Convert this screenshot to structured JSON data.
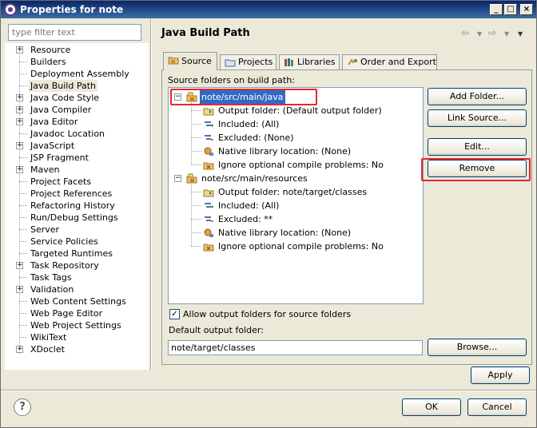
{
  "window": {
    "title": "Properties for note"
  },
  "filter": {
    "placeholder": "type filter text"
  },
  "nav": {
    "items": [
      {
        "label": "Resource",
        "expandable": true
      },
      {
        "label": "Builders",
        "expandable": false
      },
      {
        "label": "Deployment Assembly",
        "expandable": false
      },
      {
        "label": "Java Build Path",
        "expandable": false,
        "selected": true
      },
      {
        "label": "Java Code Style",
        "expandable": true
      },
      {
        "label": "Java Compiler",
        "expandable": true
      },
      {
        "label": "Java Editor",
        "expandable": true
      },
      {
        "label": "Javadoc Location",
        "expandable": false
      },
      {
        "label": "JavaScript",
        "expandable": true
      },
      {
        "label": "JSP Fragment",
        "expandable": false
      },
      {
        "label": "Maven",
        "expandable": true
      },
      {
        "label": "Project Facets",
        "expandable": false
      },
      {
        "label": "Project References",
        "expandable": false
      },
      {
        "label": "Refactoring History",
        "expandable": false
      },
      {
        "label": "Run/Debug Settings",
        "expandable": false
      },
      {
        "label": "Server",
        "expandable": false
      },
      {
        "label": "Service Policies",
        "expandable": false
      },
      {
        "label": "Targeted Runtimes",
        "expandable": false
      },
      {
        "label": "Task Repository",
        "expandable": true
      },
      {
        "label": "Task Tags",
        "expandable": false
      },
      {
        "label": "Validation",
        "expandable": true
      },
      {
        "label": "Web Content Settings",
        "expandable": false
      },
      {
        "label": "Web Page Editor",
        "expandable": false
      },
      {
        "label": "Web Project Settings",
        "expandable": false
      },
      {
        "label": "WikiText",
        "expandable": false
      },
      {
        "label": "XDoclet",
        "expandable": true
      }
    ]
  },
  "page": {
    "title": "Java Build Path",
    "tabs": [
      "Source",
      "Projects",
      "Libraries",
      "Order and Export"
    ],
    "active_tab": "Source",
    "section_label": "Source folders on build path:",
    "tree": [
      {
        "label": "note/src/main/java",
        "icon": "package-folder-icon",
        "level": 0,
        "selected": true
      },
      {
        "label": "Output folder: (Default output folder)",
        "icon": "output-folder-icon",
        "level": 1
      },
      {
        "label": "Included: (All)",
        "icon": "included-filter-icon",
        "level": 1
      },
      {
        "label": "Excluded: (None)",
        "icon": "excluded-filter-icon",
        "level": 1
      },
      {
        "label": "Native library location: (None)",
        "icon": "native-library-icon",
        "level": 1
      },
      {
        "label": "Ignore optional compile problems: No",
        "icon": "ignore-problems-icon",
        "level": 1
      },
      {
        "label": "note/src/main/resources",
        "icon": "package-folder-icon",
        "level": 0
      },
      {
        "label": "Output folder: note/target/classes",
        "icon": "output-folder-icon",
        "level": 1
      },
      {
        "label": "Included: (All)",
        "icon": "included-filter-icon",
        "level": 1
      },
      {
        "label": "Excluded: **",
        "icon": "excluded-filter-icon",
        "level": 1
      },
      {
        "label": "Native library location: (None)",
        "icon": "native-library-icon",
        "level": 1
      },
      {
        "label": "Ignore optional compile problems: No",
        "icon": "ignore-problems-icon",
        "level": 1
      }
    ],
    "buttons": {
      "add_folder": "Add Folder...",
      "link_source": "Link Source...",
      "edit": "Edit...",
      "remove": "Remove",
      "browse": "Browse..."
    },
    "allow_output_label": "Allow output folders for source folders",
    "allow_output_checked": true,
    "default_output_label": "Default output folder:",
    "default_output_value": "note/target/classes"
  },
  "footer": {
    "apply": "Apply",
    "ok": "OK",
    "cancel": "Cancel",
    "help": "?"
  },
  "colors": {
    "selection": "#316ac5",
    "highlight": "#e5262e",
    "titlebar": "#0a246a"
  }
}
